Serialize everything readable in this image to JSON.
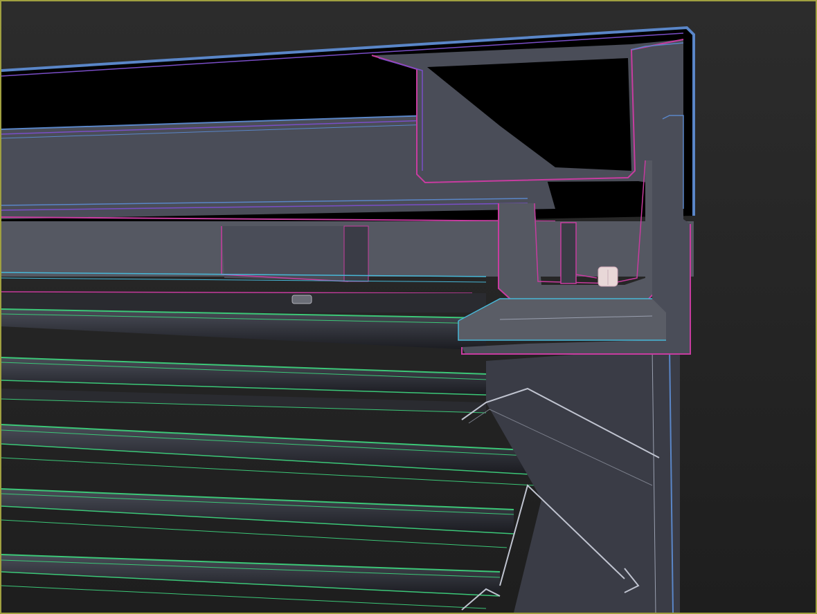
{
  "viewport": {
    "active_border_color": "#a0a040",
    "render_mode": "shaded-with-edged-faces"
  },
  "palette": {
    "background_top": "#2a2a2a",
    "background_bottom": "#1c1c1c",
    "surface_dark": "#333641",
    "surface_mid": "#4a4d58",
    "surface_light": "#5a5d66",
    "void": "#000000",
    "edge_blue": "#5a86c8",
    "edge_purple": "#7a4ec8",
    "edge_magenta": "#c83ca0",
    "edge_cyan": "#48b8d8",
    "edge_green": "#3cc878",
    "nut_color": "#e8d8d8"
  },
  "objects": [
    {
      "name": "top-channel-beam",
      "edge_color": "edge_blue"
    },
    {
      "name": "c-channel-rail",
      "edge_color": "edge_magenta"
    },
    {
      "name": "mounting-block",
      "edge_color": "edge_magenta"
    },
    {
      "name": "angle-bracket",
      "edge_color": "edge_magenta"
    },
    {
      "name": "hex-nut",
      "edge_color": "nut_color"
    },
    {
      "name": "louver-slats",
      "edge_color": "edge_green",
      "count": 8
    },
    {
      "name": "side-frame",
      "edge_color": "edge_blue"
    }
  ]
}
